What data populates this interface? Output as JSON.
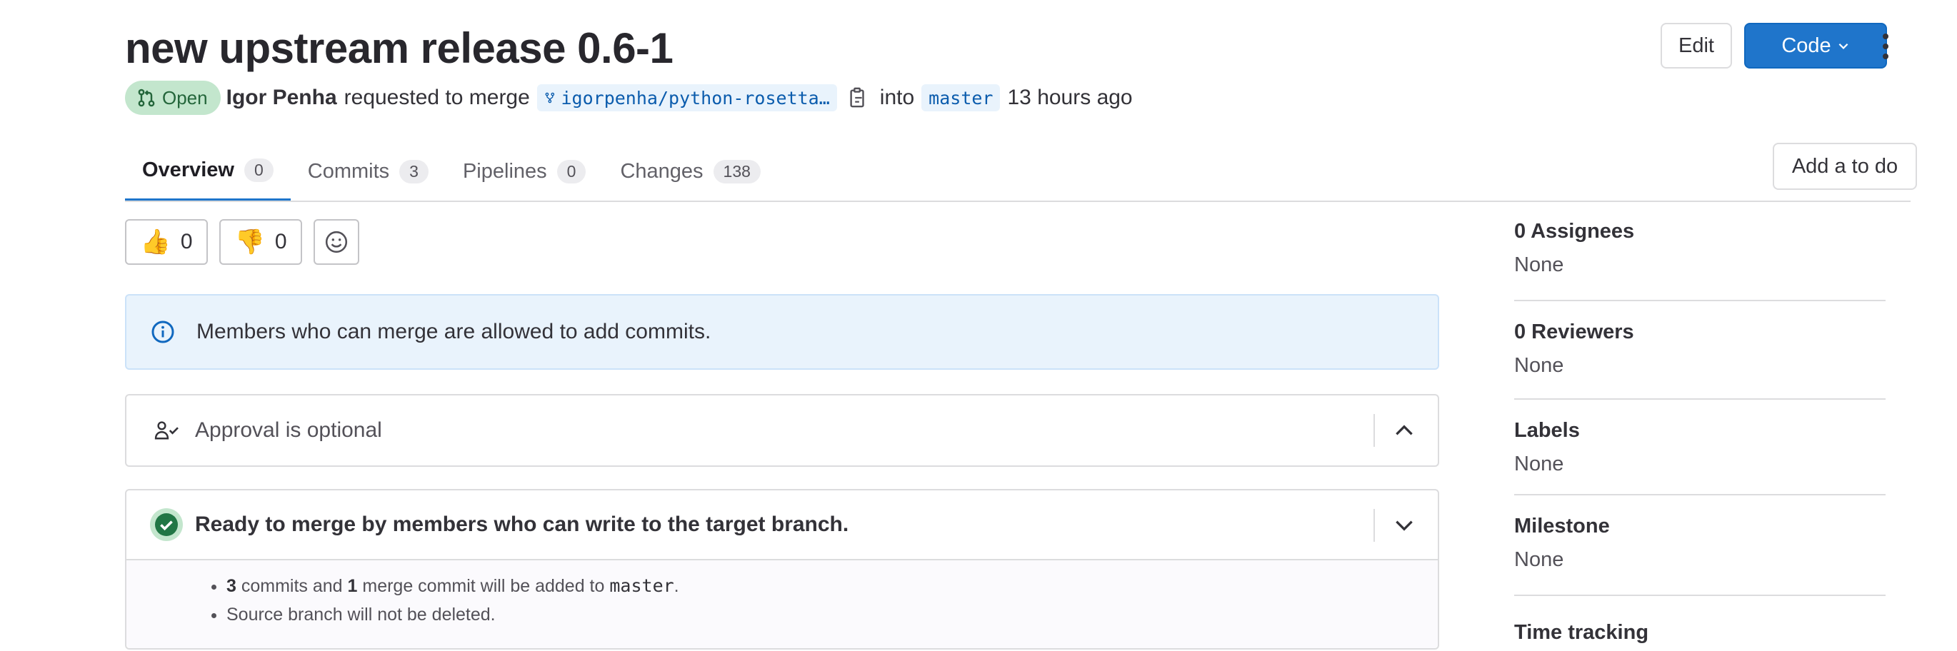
{
  "header": {
    "title": "new upstream release 0.6-1",
    "edit_label": "Edit",
    "code_label": "Code"
  },
  "meta": {
    "status": "Open",
    "author": "Igor Penha",
    "action": "requested to merge",
    "source_branch": "igorpenha/python-rosetta…",
    "into": "into",
    "target_branch": "master",
    "time": "13 hours ago"
  },
  "tabs": [
    {
      "label": "Overview",
      "count": "0"
    },
    {
      "label": "Commits",
      "count": "3"
    },
    {
      "label": "Pipelines",
      "count": "0"
    },
    {
      "label": "Changes",
      "count": "138"
    }
  ],
  "todo_label": "Add a to do",
  "reactions": {
    "thumbs_up_count": "0",
    "thumbs_down_count": "0"
  },
  "info_message": "Members who can merge are allowed to add commits.",
  "approval": {
    "label": "Approval is optional"
  },
  "merge": {
    "title": "Ready to merge by members who can write to the target branch.",
    "commits_count": "3",
    "commits_text_1": " commits and ",
    "merge_count": "1",
    "commits_text_2": " merge commit will be added to ",
    "branch": "master",
    "period": ".",
    "delete_note": "Source branch will not be deleted."
  },
  "sidebar": {
    "assignees_title": "0 Assignees",
    "assignees_value": "None",
    "reviewers_title": "0 Reviewers",
    "reviewers_value": "None",
    "labels_title": "Labels",
    "labels_value": "None",
    "milestone_title": "Milestone",
    "milestone_value": "None",
    "time_tracking_title": "Time tracking"
  },
  "colors": {
    "accent": "#1f75cb",
    "open_badge_bg": "#c3e6cd",
    "open_badge_text": "#24663b",
    "info_bg": "#e9f3fc",
    "success": "#217645"
  }
}
